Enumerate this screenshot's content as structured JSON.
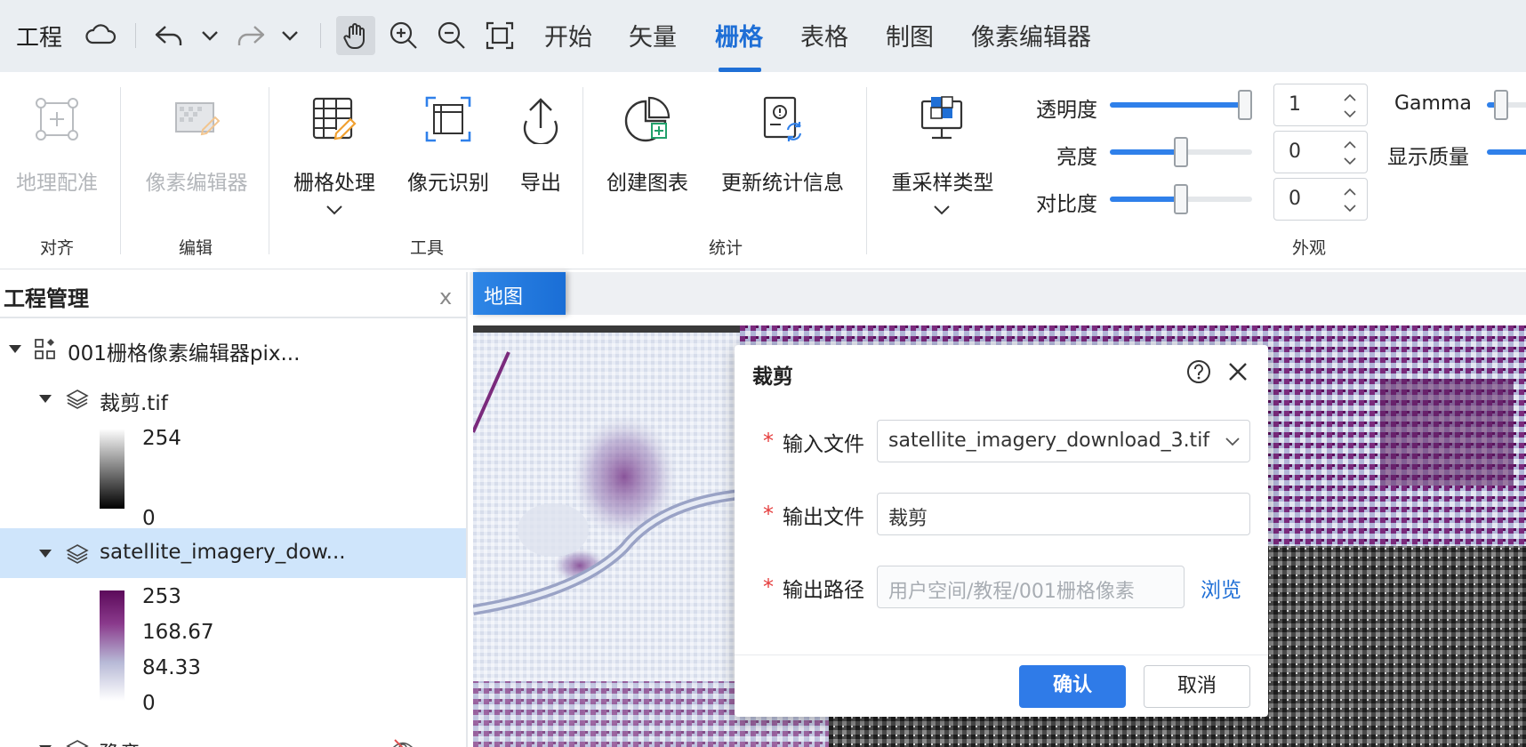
{
  "topbar": {
    "project_label": "工程",
    "tabs": [
      "开始",
      "矢量",
      "栅格",
      "表格",
      "制图",
      "像素编辑器"
    ],
    "active_tab": "栅格"
  },
  "ribbon": {
    "georef_label": "地理配准",
    "pixel_editor_label": "像素编辑器",
    "raster_process_label": "栅格处理",
    "pixel_identify_label": "像元识别",
    "export_label": "导出",
    "create_chart_label": "创建图表",
    "update_stats_label": "更新统计信息",
    "resample_label": "重采样类型",
    "groups": {
      "align": "对齐",
      "edit": "编辑",
      "tools": "工具",
      "stats": "统计",
      "appearance": "外观"
    },
    "appearance": {
      "opacity_label": "透明度",
      "opacity_value": "1",
      "opacity_level": 1.0,
      "brightness_label": "亮度",
      "brightness_value": "0",
      "brightness_level": 0.5,
      "contrast_label": "对比度",
      "contrast_value": "0",
      "contrast_level": 0.5,
      "gamma_label": "Gamma",
      "quality_label": "显示质量"
    }
  },
  "project_panel": {
    "title": "工程管理",
    "close": "x",
    "root_label": "001栅格像素编辑器pix...",
    "layer1": {
      "label": "裁剪.tif",
      "max": "254",
      "min": "0"
    },
    "layer2": {
      "label": "satellite_imagery_dow...",
      "values": [
        "253",
        "168.67",
        "84.33",
        "0"
      ]
    },
    "layer3": {
      "label": "豫章.pgv.pgv"
    }
  },
  "map": {
    "tab_label": "地图"
  },
  "dialog": {
    "title": "裁剪",
    "input_file_label": "输入文件",
    "input_file_value": "satellite_imagery_download_3.tif",
    "output_file_label": "输出文件",
    "output_file_value": "裁剪",
    "output_path_label": "输出路径",
    "output_path_placeholder": "用户空间/教程/001栅格像素",
    "browse_label": "浏览",
    "ok_label": "确认",
    "cancel_label": "取消",
    "required_mark": "*"
  }
}
